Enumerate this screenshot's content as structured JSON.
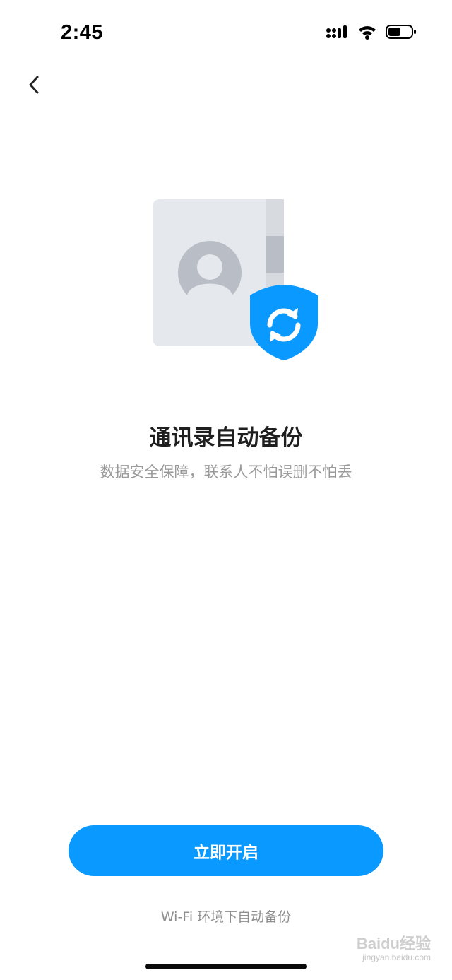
{
  "status_bar": {
    "time": "2:45",
    "icons": [
      "signal-icon",
      "wifi-icon",
      "battery-icon"
    ]
  },
  "nav": {
    "back_icon": "chevron-left-icon"
  },
  "illustration": {
    "icon": "contacts-book-shield-sync-icon",
    "colors": {
      "book": "#e5e8ec",
      "avatar": "#b9bec6",
      "shield": "#0a99ff"
    }
  },
  "main": {
    "title": "通讯录自动备份",
    "subtitle": "数据安全保障，联系人不怕误删不怕丢"
  },
  "actions": {
    "enable_label": "立即开启",
    "hint": "Wi-Fi 环境下自动备份"
  },
  "watermark": {
    "brand": "Baidu经验",
    "domain": "jingyan.baidu.com"
  },
  "colors": {
    "accent": "#0a99ff",
    "title_text": "#1f1f1f",
    "secondary_text": "#9a9a9a"
  }
}
